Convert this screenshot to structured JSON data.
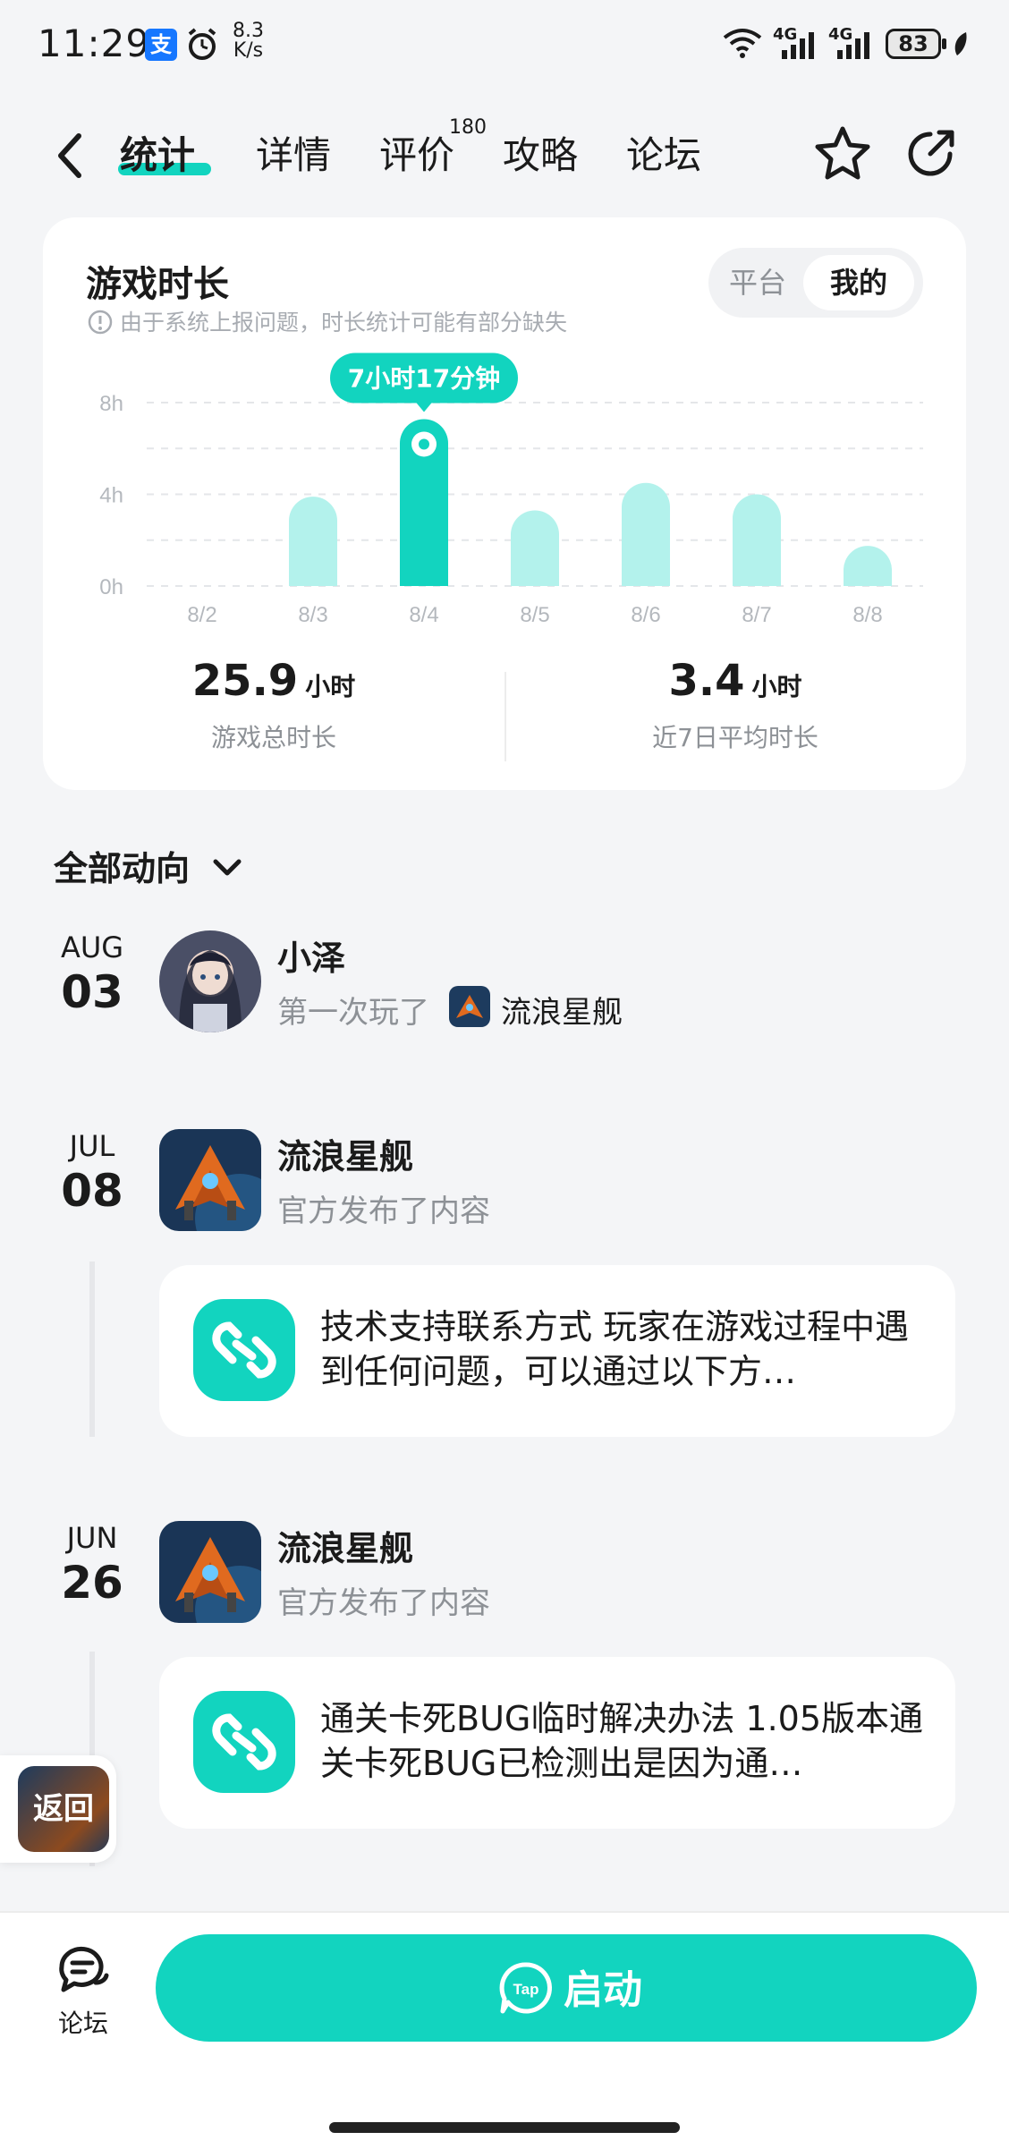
{
  "status_bar": {
    "time": "11:29",
    "net_speed_value": "8.3",
    "net_speed_unit": "K/s",
    "signal_1": "4G",
    "signal_2": "4G",
    "battery": "83"
  },
  "header": {
    "tabs": [
      {
        "label": "统计",
        "active": true
      },
      {
        "label": "详情",
        "active": false
      },
      {
        "label": "评价",
        "active": false,
        "badge": "180"
      },
      {
        "label": "攻略",
        "active": false
      },
      {
        "label": "论坛",
        "active": false
      }
    ],
    "icons": [
      "back-arrow-icon",
      "star-icon",
      "share-icon"
    ]
  },
  "stats": {
    "title": "游戏时长",
    "note": "由于系统上报问题，时长统计可能有部分缺失",
    "toggle": {
      "options": [
        "平台",
        "我的"
      ],
      "selected": "我的"
    },
    "total_value": "25.9",
    "total_unit": "小时",
    "total_label": "游戏总时长",
    "avg_value": "3.4",
    "avg_unit": "小时",
    "avg_label": "近7日平均时长"
  },
  "chart_data": {
    "type": "bar",
    "categories": [
      "8/2",
      "8/3",
      "8/4",
      "8/5",
      "8/6",
      "8/7",
      "8/8"
    ],
    "values": [
      0,
      3.9,
      7.28,
      3.3,
      4.5,
      4.0,
      1.4
    ],
    "y_tick_labels": [
      "8h",
      "4h",
      "0h"
    ],
    "ylim": [
      0,
      8
    ],
    "highlight_index": 2,
    "highlight_label": "7小时17分钟",
    "colors": {
      "bar": "#b3f2ec",
      "highlight": "#12d4bf"
    }
  },
  "activity": {
    "filter_label": "全部动向",
    "items": [
      {
        "month": "AUG",
        "day": "03",
        "name": "小泽",
        "action": "第一次玩了",
        "game": "流浪星舰"
      },
      {
        "month": "JUL",
        "day": "08",
        "name": "流浪星舰",
        "action": "官方发布了内容",
        "post": "技术支持联系方式 玩家在游戏过程中遇到任何问题，可以通过以下方…"
      },
      {
        "month": "JUN",
        "day": "26",
        "name": "流浪星舰",
        "action": "官方发布了内容",
        "post": "通关卡死BUG临时解决办法 1.05版本通关卡死BUG已检测出是因为通…"
      }
    ]
  },
  "float_back": {
    "label": "返回"
  },
  "bottom_bar": {
    "forum_label": "论坛",
    "launch_label": "启动",
    "tap_logo": "Tap"
  },
  "colors": {
    "accent": "#12d4bf",
    "accent_light": "#b3f2ec",
    "background": "#f4f5f7"
  }
}
